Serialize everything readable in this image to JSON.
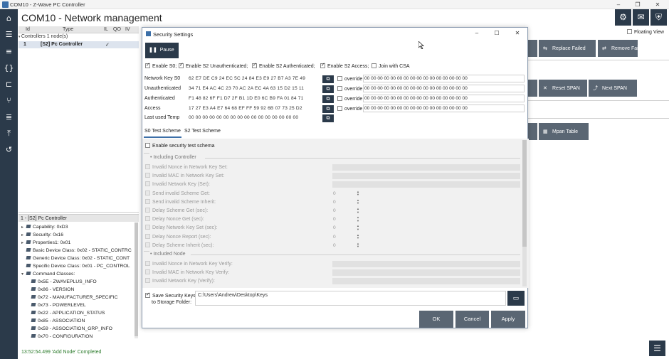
{
  "window": {
    "title": "COM10 - Z-Wave PC Controller"
  },
  "page": {
    "title": "COM10 - Network management"
  },
  "toolbar": {
    "icons": [
      "gear-icon",
      "mail-icon",
      "shield-icon"
    ]
  },
  "floating_view": {
    "label": "Floating View",
    "checked": false
  },
  "nodes_table": {
    "columns": [
      "Id",
      "Type",
      "IL",
      "QO",
      "IV"
    ],
    "group_label": "Controllers 1 node(s)",
    "rows": [
      {
        "id": "1",
        "type": "[S2] Pc Controller",
        "il": "✓"
      }
    ]
  },
  "node_panel": {
    "title": "1 - [S2] Pc Controller",
    "items": [
      {
        "label": "Capability: 0xD3",
        "expandable": true
      },
      {
        "label": "Security: 0x16",
        "expandable": true
      },
      {
        "label": "Properties1: 0x01",
        "expandable": true
      },
      {
        "label": "Basic Device Class: 0x02 - STATIC_CONTRC",
        "expandable": false
      },
      {
        "label": "Generic Device Class: 0x02 - STATIC_CONT",
        "expandable": false
      },
      {
        "label": "Specific Device Class: 0x01 - PC_CONTROL",
        "expandable": false
      },
      {
        "label": "Command Classes:",
        "expandable": true,
        "expanded": true
      },
      {
        "label": "0x5E - ZWAVEPLUS_INFO",
        "child": true
      },
      {
        "label": "0x86 - VERSION",
        "child": true
      },
      {
        "label": "0x72 - MANUFACTURER_SPECIFIC",
        "child": true
      },
      {
        "label": "0x73 - POWERLEVEL",
        "child": true
      },
      {
        "label": "0x22 - APPLICATION_STATUS",
        "child": true
      },
      {
        "label": "0x85 - ASSOCIATION",
        "child": true
      },
      {
        "label": "0x59 - ASSOCIATION_GRP_INFO",
        "child": true
      },
      {
        "label": "0x70 - CONFIGURATION",
        "child": true
      }
    ]
  },
  "actions": {
    "replace_failed": "Replace Failed",
    "remove_failed": "Remove Failed",
    "reset_span": "Reset SPAN",
    "next_span": "Next SPAN",
    "mpan_table": "Mpan Table"
  },
  "status": {
    "text": "13:52:54.499 'Add Node' Completed"
  },
  "dialog": {
    "title": "Security Settings",
    "pause_label": "Pause",
    "options": [
      {
        "label": "Enable S0;",
        "checked": true
      },
      {
        "label": "Enable S2 Unauthenticated;",
        "checked": true
      },
      {
        "label": "Enable S2 Authenticated;",
        "checked": true
      },
      {
        "label": "Enable S2 Access;",
        "checked": true
      },
      {
        "label": "Join with CSA",
        "checked": false
      }
    ],
    "keys": [
      {
        "label": "Network Key S0",
        "value": "62 E7 DE C9 24 EC 5C 24 84 E3 E9 27 B7 A3 7E 49",
        "override_label": "override",
        "override_value": "00 00 00 00 00 00 00 00 00 00 00 00 00 00 00 00"
      },
      {
        "label": "Unauthenticated",
        "value": "34 71 E4 AC 4C 23 70 AC 2A EC 4A 63 15 D2 15 11",
        "override_label": "override",
        "override_value": "00 00 00 00 00 00 00 00 00 00 00 00 00 00 00 00"
      },
      {
        "label": "Authenticated",
        "value": "F1 48 82 6F F1 D7 2F B1 1D E0 6C B9 FA 01 84 71",
        "override_label": "override",
        "override_value": "00 00 00 00 00 00 00 00 00 00 00 00 00 00 00 00"
      },
      {
        "label": "Access",
        "value": "17 27 E3 A4 E7 64 68 EF FF 59 92 6B 07 73 25 D2",
        "override_label": "override",
        "override_value": "00 00 00 00 00 00 00 00 00 00 00 00 00 00 00 00"
      },
      {
        "label": "Last used Temp",
        "value": "00 00 00 00 00 00 00 00 00 00 00 00 00 00 00 00"
      }
    ],
    "tabs": [
      "S0 Test Scheme",
      "S2 Test Scheme"
    ],
    "active_tab": "S0 Test Scheme",
    "enable_schema": {
      "label": "Enable security test schema",
      "checked": false
    },
    "including_controller": {
      "title": "Including Controller",
      "rows": [
        {
          "label": "Invalid Nonce in Network Key Set:",
          "kind": "text",
          "value": ""
        },
        {
          "label": "Invalid MAC in Network Key Set:",
          "kind": "text",
          "value": ""
        },
        {
          "label": "Invalid Network Key  (Set):",
          "kind": "text",
          "value": ""
        },
        {
          "label": "Send invalid Scheme Get:",
          "kind": "spin",
          "value": "0"
        },
        {
          "label": "Send invalid Scheme Inherit:",
          "kind": "spin",
          "value": "0"
        },
        {
          "label": "Delay Scheme Get (sec):",
          "kind": "spin",
          "value": "0"
        },
        {
          "label": "Delay Nonce Get (sec):",
          "kind": "spin",
          "value": "0"
        },
        {
          "label": "Delay Network Key Set (sec):",
          "kind": "spin",
          "value": "0"
        },
        {
          "label": "Delay Nonce Report (sec):",
          "kind": "spin",
          "value": "0"
        },
        {
          "label": "Delay Scheme Inherit (sec):",
          "kind": "spin",
          "value": "0"
        }
      ]
    },
    "included_node": {
      "title": "Included Node",
      "rows": [
        {
          "label": "Invalid Nonce in Network Key Verify:",
          "kind": "text",
          "value": ""
        },
        {
          "label": "Invalid MAC in Network Key Verify:",
          "kind": "text",
          "value": ""
        },
        {
          "label": "Invalid Network Key  (Verify):",
          "kind": "text",
          "value": ""
        }
      ]
    },
    "save_keys": {
      "label_line1": "Save Security Keys",
      "label_line2": "to Storage Folder:",
      "checked": true,
      "path": "C:\\Users\\Andrew\\Desktop\\Keys"
    },
    "buttons": {
      "ok": "OK",
      "cancel": "Cancel",
      "apply": "Apply"
    }
  },
  "colors": {
    "nav": "#2b3a4a",
    "action_button": "#5a6673",
    "accent": "#3c6fa8",
    "status_ok": "#2a7a2a"
  }
}
